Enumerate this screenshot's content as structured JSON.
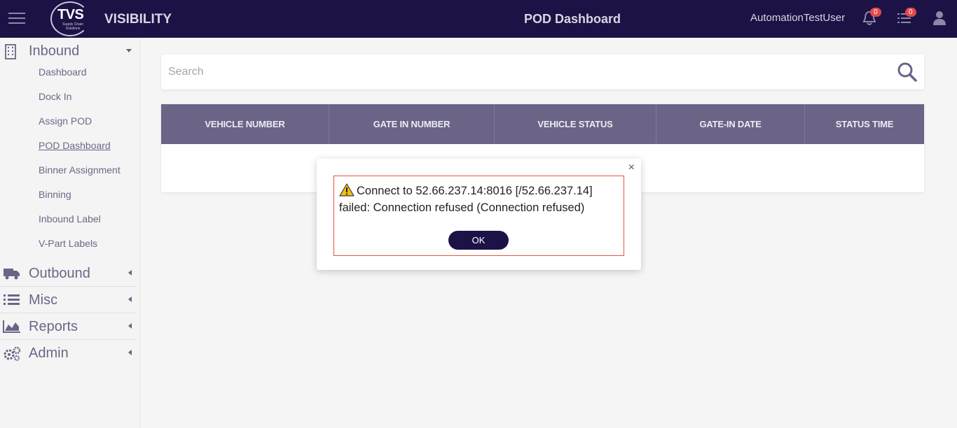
{
  "header": {
    "logo_text": "TVS",
    "logo_sub": "Supply Chain Solutions",
    "app_name": "VISIBILITY",
    "page_title": "POD Dashboard",
    "username": "AutomationTestUser",
    "notification_count": "0",
    "task_count": "0"
  },
  "sidebar": {
    "inbound": {
      "label": "Inbound",
      "items": [
        "Dashboard",
        "Dock In",
        "Assign POD",
        "POD Dashboard",
        "Binner Assignment",
        "Binning",
        "Inbound Label",
        "V-Part Labels"
      ]
    },
    "outbound": "Outbound",
    "misc": "Misc",
    "reports": "Reports",
    "admin": "Admin"
  },
  "search": {
    "placeholder": "Search"
  },
  "table": {
    "columns": [
      "VEHICLE NUMBER",
      "GATE IN NUMBER",
      "VEHICLE STATUS",
      "GATE-IN DATE",
      "STATUS TIME"
    ]
  },
  "dialog": {
    "close": "×",
    "message": "Connect to 52.66.237.14:8016 [/52.66.237.14] failed: Connection refused (Connection refused)",
    "ok_label": "OK"
  },
  "colors": {
    "primary": "#1c1245",
    "error_border": "#e6553a",
    "badge": "#e04a4a"
  }
}
